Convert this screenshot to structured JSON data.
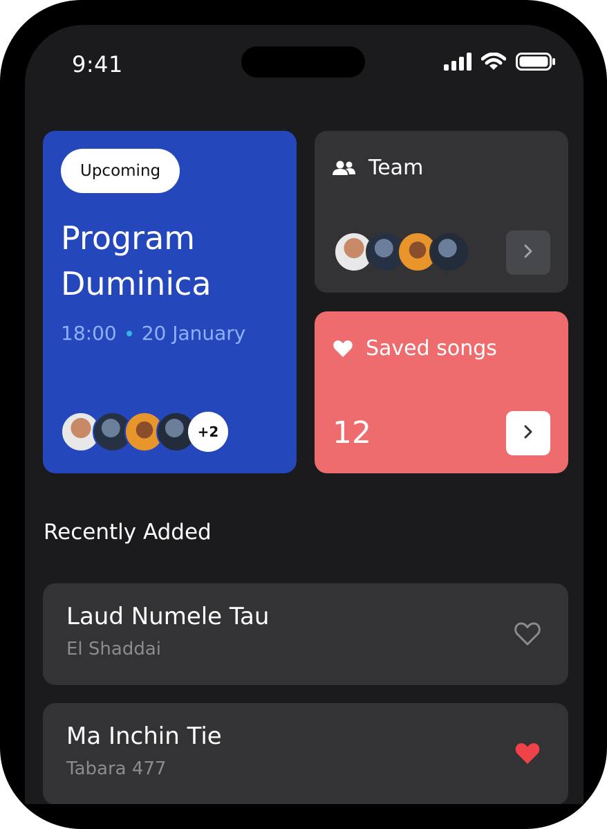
{
  "status_bar": {
    "time": "9:41"
  },
  "program_card": {
    "badge": "Upcoming",
    "title": "Program Duminica",
    "time": "18:00",
    "date": "20 January",
    "more_count": "+2",
    "colors": {
      "background": "#2448bb",
      "time_text": "#8fb0ff",
      "dot": "#35b4e6"
    }
  },
  "team_card": {
    "label": "Team",
    "icon": "people-icon"
  },
  "saved_card": {
    "label": "Saved songs",
    "count": "12",
    "icon": "heart-icon",
    "colors": {
      "background": "#ee6b6e"
    }
  },
  "recently_added": {
    "title": "Recently Added",
    "songs": [
      {
        "title": "Laud Numele Tau",
        "artist": "El Shaddai",
        "favorite": false
      },
      {
        "title": "Ma Inchin Tie",
        "artist": "Tabara 477",
        "favorite": true
      }
    ]
  },
  "colors": {
    "screen_bg": "#1b1b1d",
    "card_bg": "#333336",
    "favorite": "#ef4349"
  }
}
